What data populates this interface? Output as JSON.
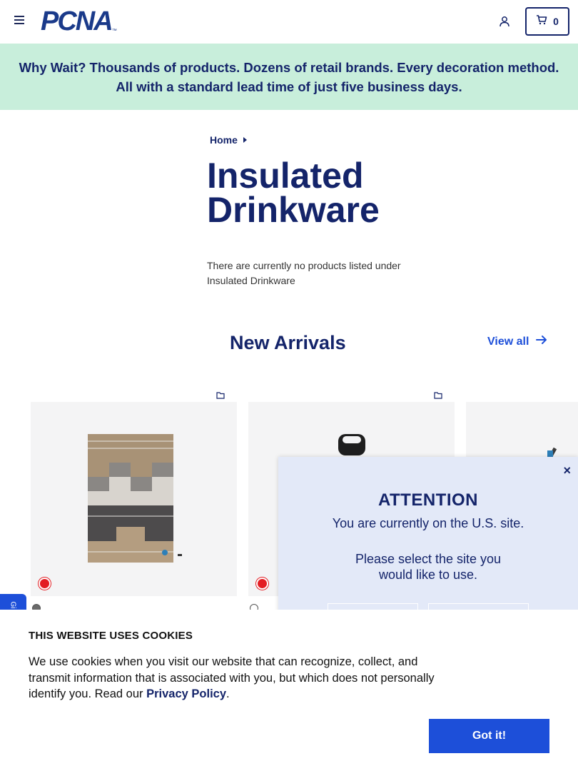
{
  "header": {
    "logo_text": "PCNA",
    "logo_tm": "™",
    "cart_count": "0"
  },
  "promo": {
    "lead": "Why Wait?",
    "text": " Thousands of products. Dozens of retail brands. Every decoration method. All with a standard lead time of just five business days."
  },
  "breadcrumb": {
    "home": "Home"
  },
  "page": {
    "title": "Insulated Drinkware",
    "empty_message": "There are currently no products listed under Insulated Drinkware"
  },
  "arrivals": {
    "title": "New Arrivals",
    "view_all": "View all"
  },
  "modal": {
    "title": "ATTENTION",
    "line1": "You are currently on the U.S. site.",
    "line2": "Please select the site you would like to use.",
    "close": "×"
  },
  "side_tab": {
    "label": "Gi"
  },
  "cookie": {
    "title": "THIS WEBSITE USES COOKIES",
    "text": "We use cookies when you visit our website that can recognize, collect, and transmit information that is associated with you, but which does not personally identify you. Read our ",
    "link": "Privacy Policy",
    "period": ".",
    "button": "Got it!"
  },
  "colors": {
    "navy": "#14246a",
    "accent_blue": "#1d4fd9",
    "promo_bg": "#c8eedb",
    "modal_bg": "#e3e9f8",
    "badge_red": "#e31d23"
  },
  "icons": [
    "menu-icon",
    "account-icon",
    "cart-icon",
    "arrow-right-icon",
    "bookmark-icon"
  ]
}
